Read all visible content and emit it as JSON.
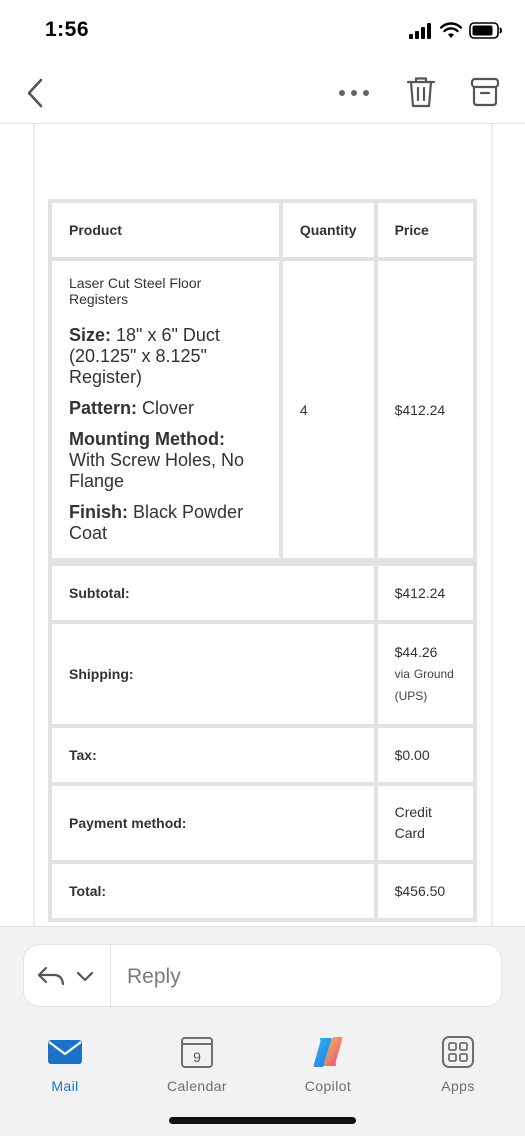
{
  "status_bar": {
    "time": "1:56"
  },
  "order": {
    "headers": {
      "product": "Product",
      "quantity": "Quantity",
      "price": "Price"
    },
    "item": {
      "name": "Laser Cut Steel Floor Registers",
      "size_label": "Size:",
      "size_value": "18\" x 6\" Duct (20.125\" x 8.125\" Register)",
      "pattern_label": "Pattern:",
      "pattern_value": "Clover",
      "mounting_label": "Mounting Method:",
      "mounting_value": "With Screw Holes, No Flange",
      "finish_label": "Finish:",
      "finish_value": "Black Powder Coat",
      "quantity": "4",
      "price": "$412.24"
    },
    "totals": {
      "subtotal_label": "Subtotal:",
      "subtotal_value": "$412.24",
      "shipping_label": "Shipping:",
      "shipping_amount": "$44.26",
      "shipping_via": "via",
      "shipping_method": "Ground (UPS)",
      "tax_label": "Tax:",
      "tax_value": "$0.00",
      "payment_label": "Payment method:",
      "payment_value": "Credit Card",
      "total_label": "Total:",
      "total_value": "$456.50"
    }
  },
  "reply": {
    "placeholder": "Reply"
  },
  "tabs": [
    {
      "label": "Mail",
      "icon": "mail-icon",
      "active": true
    },
    {
      "label": "Calendar",
      "icon": "calendar-icon",
      "day": "9"
    },
    {
      "label": "Copilot",
      "icon": "copilot-icon"
    },
    {
      "label": "Apps",
      "icon": "apps-icon"
    }
  ],
  "colors": {
    "accent": "#1a73c9",
    "tab_bg": "#f2f2f4",
    "border": "#e2e2e2"
  }
}
